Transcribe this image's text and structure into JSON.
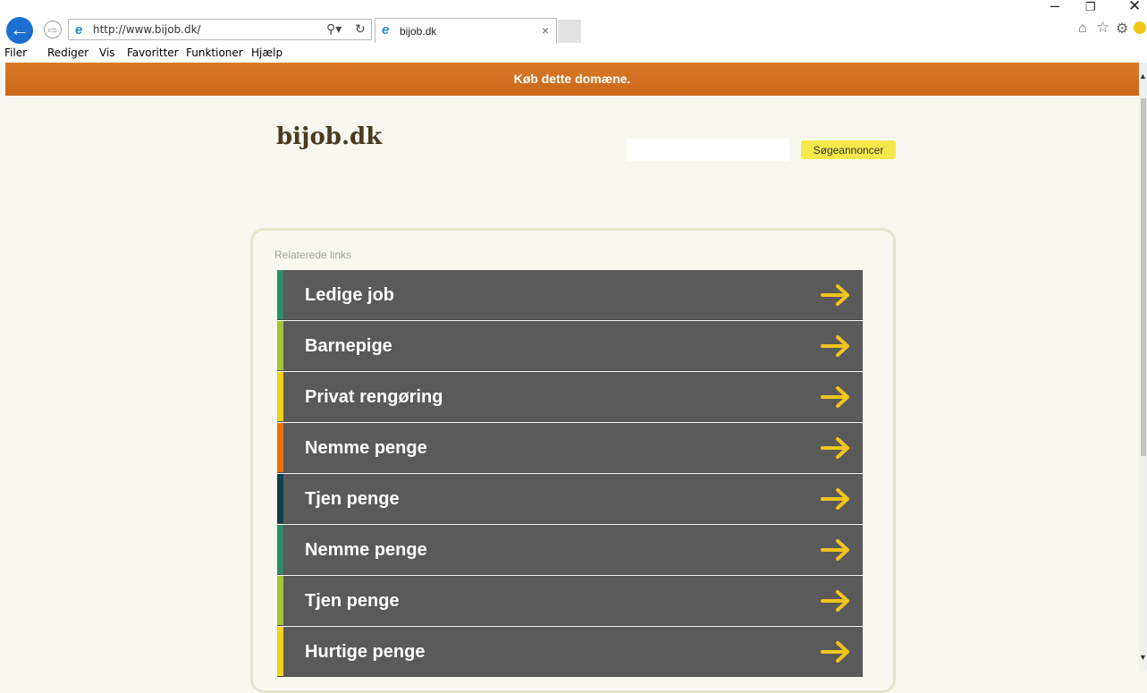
{
  "browser": {
    "url": "http://www.bijob.dk/",
    "tab_title": "bijob.dk",
    "window_controls": {
      "minimize": "–",
      "restore": "❐",
      "close": "✕"
    },
    "toolbar_icons": [
      "home-icon",
      "favorites-star-icon",
      "settings-gear-icon",
      "feedback-smiley-icon"
    ]
  },
  "menu": {
    "items": [
      "Filer",
      "Rediger",
      "Vis",
      "Favoritter",
      "Funktioner",
      "Hjælp"
    ]
  },
  "banner": {
    "text": "Køb dette domæne."
  },
  "site": {
    "title": "bijob.dk",
    "search_button": "Søgeannoncer",
    "search_value": ""
  },
  "links": {
    "label": "Relaterede links",
    "items": [
      {
        "text": "Ledige job",
        "color": "#2f8a6a"
      },
      {
        "text": "Barnepige",
        "color": "#a4c43c"
      },
      {
        "text": "Privat rengøring",
        "color": "#f2d21c"
      },
      {
        "text": "Nemme penge",
        "color": "#e8720c"
      },
      {
        "text": "Tjen penge",
        "color": "#0e3e4e"
      },
      {
        "text": "Nemme penge",
        "color": "#2f8a6a"
      },
      {
        "text": "Tjen penge",
        "color": "#a4c43c"
      },
      {
        "text": "Hurtige penge",
        "color": "#f2d21c"
      }
    ],
    "arrow_color": "#f2c51c"
  },
  "colors": {
    "banner": "#d0701f",
    "page_bg": "#f8f8f1",
    "row_bg": "#5a5a5a",
    "search_button_bg": "#f5e84a"
  }
}
